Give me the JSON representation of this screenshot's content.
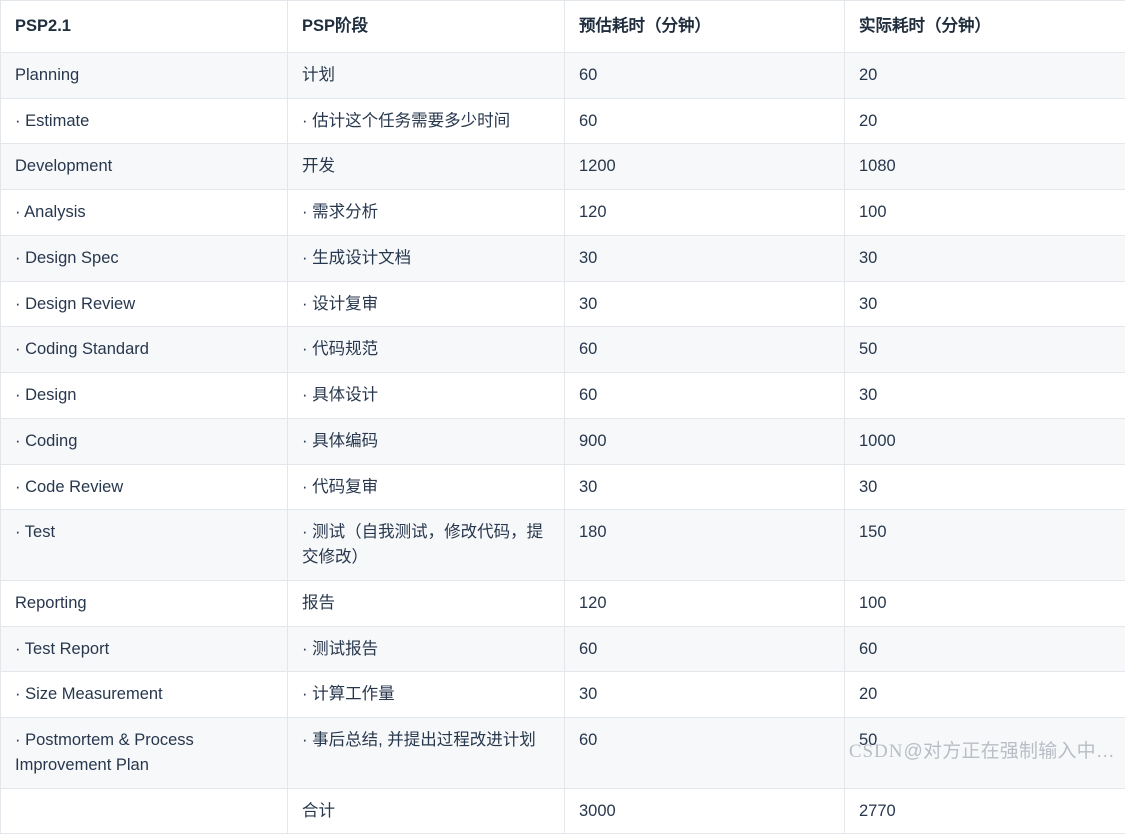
{
  "table": {
    "headers": [
      "PSP2.1",
      "PSP阶段",
      "预估耗时（分钟）",
      "实际耗时（分钟）"
    ],
    "rows": [
      {
        "psp": "Planning",
        "stage": "计划",
        "estimate": "60",
        "actual": "20"
      },
      {
        "psp": "· Estimate",
        "stage": "· 估计这个任务需要多少时间",
        "estimate": "60",
        "actual": "20"
      },
      {
        "psp": "Development",
        "stage": "开发",
        "estimate": "1200",
        "actual": "1080"
      },
      {
        "psp": "· Analysis",
        "stage": "· 需求分析",
        "estimate": "120",
        "actual": "100"
      },
      {
        "psp": "· Design Spec",
        "stage": "· 生成设计文档",
        "estimate": "30",
        "actual": "30"
      },
      {
        "psp": "· Design Review",
        "stage": "· 设计复审",
        "estimate": "30",
        "actual": "30"
      },
      {
        "psp": "· Coding Standard",
        "stage": "· 代码规范",
        "estimate": "60",
        "actual": "50"
      },
      {
        "psp": "· Design",
        "stage": "· 具体设计",
        "estimate": "60",
        "actual": "30"
      },
      {
        "psp": "· Coding",
        "stage": "· 具体编码",
        "estimate": "900",
        "actual": "1000"
      },
      {
        "psp": "· Code Review",
        "stage": "· 代码复审",
        "estimate": "30",
        "actual": "30"
      },
      {
        "psp": "· Test",
        "stage": "· 测试（自我测试，修改代码，提交修改）",
        "estimate": "180",
        "actual": "150"
      },
      {
        "psp": "Reporting",
        "stage": "报告",
        "estimate": "120",
        "actual": "100"
      },
      {
        "psp": "· Test Report",
        "stage": "· 测试报告",
        "estimate": "60",
        "actual": "60"
      },
      {
        "psp": "· Size Measurement",
        "stage": "· 计算工作量",
        "estimate": "30",
        "actual": "20"
      },
      {
        "psp": "· Postmortem & Process Improvement Plan",
        "stage": "· 事后总结, 并提出过程改进计划",
        "estimate": "60",
        "actual": "50"
      },
      {
        "psp": "",
        "stage": "合计",
        "estimate": "3000",
        "actual": "2770"
      }
    ]
  },
  "watermark": {
    "brand": "CSDN",
    "handle": "@对方正在强制输入中…"
  }
}
